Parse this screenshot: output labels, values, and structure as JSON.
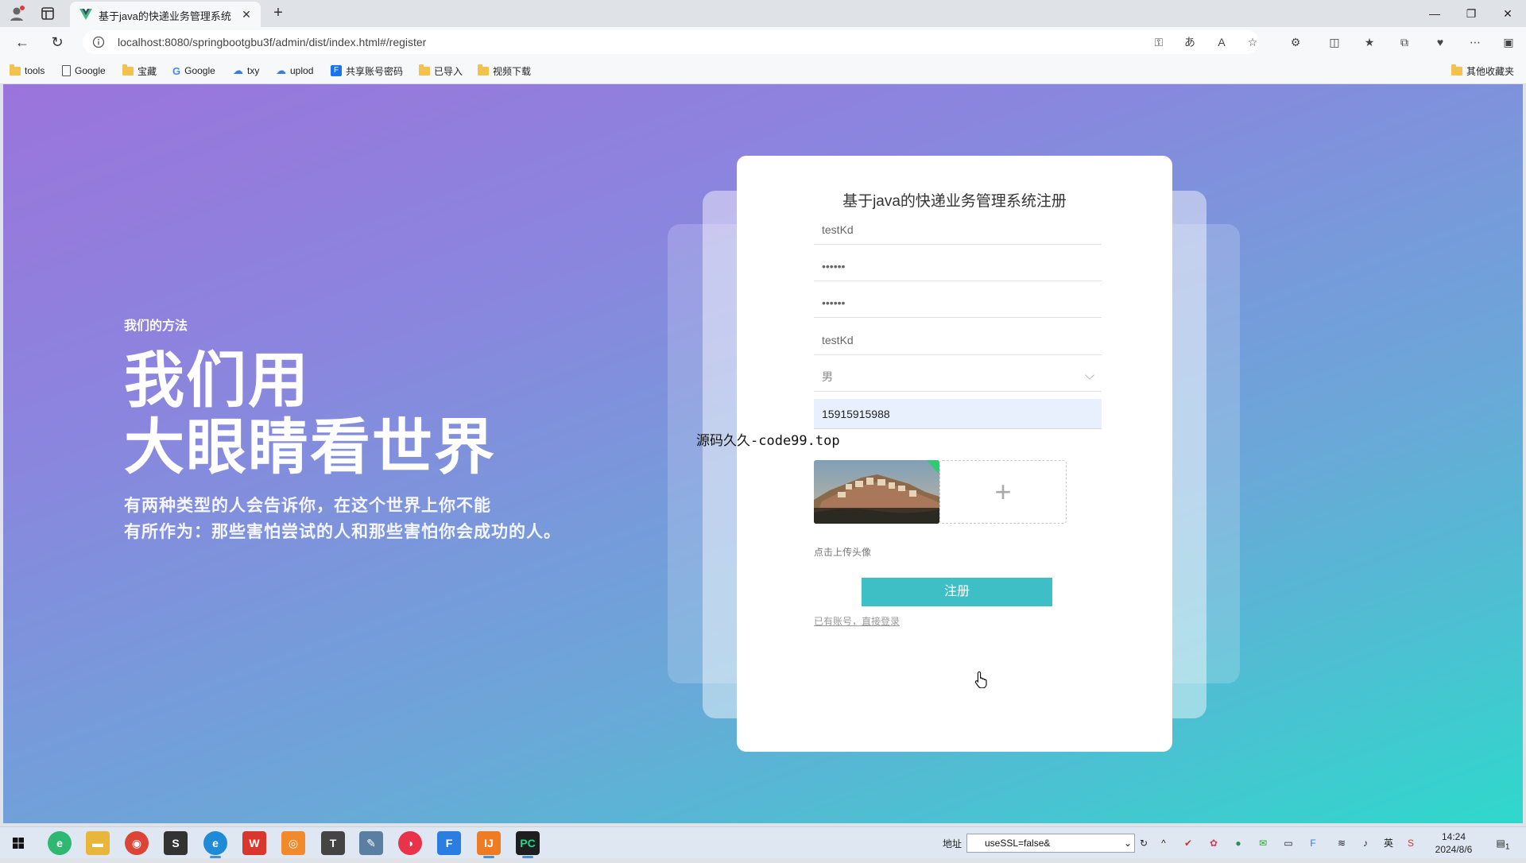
{
  "browser": {
    "tab_title": "基于java的快递业务管理系统",
    "url": "localhost:8080/springbootgbu3f/admin/dist/index.html#/register",
    "bookmarks": [
      "tools",
      "Google",
      "宝藏",
      "Google",
      "txy",
      "uplod",
      "共享账号密码",
      "已导入",
      "视频下载"
    ],
    "other_bookmarks": "其他收藏夹"
  },
  "hero": {
    "eyebrow": "我们的方法",
    "headline_line1": "我们用",
    "headline_line2": "大眼睛看世界",
    "desc_line1": "有两种类型的人会告诉你，在这个世界上你不能",
    "desc_line2": "有所作为：那些害怕尝试的人和那些害怕你会成功的人。"
  },
  "form": {
    "title": "基于java的快递业务管理系统注册",
    "username": "testKd",
    "password": "••••••",
    "confirm_password": "••••••",
    "name": "testKd",
    "gender": "男",
    "phone": "15915915988",
    "upload_hint": "点击上传头像",
    "register_label": "注册",
    "login_link": "已有账号，直接登录"
  },
  "watermark": "源码久久-code99.top",
  "taskbar": {
    "address_label": "地址",
    "address_value": "useSSL=false&",
    "ime": "英",
    "time": "14:24",
    "date": "2024/8/6",
    "notif_count": "1"
  },
  "colors": {
    "accent": "#3ebfc6",
    "bg_start": "#9b74dc",
    "bg_end": "#2fd8cc"
  }
}
